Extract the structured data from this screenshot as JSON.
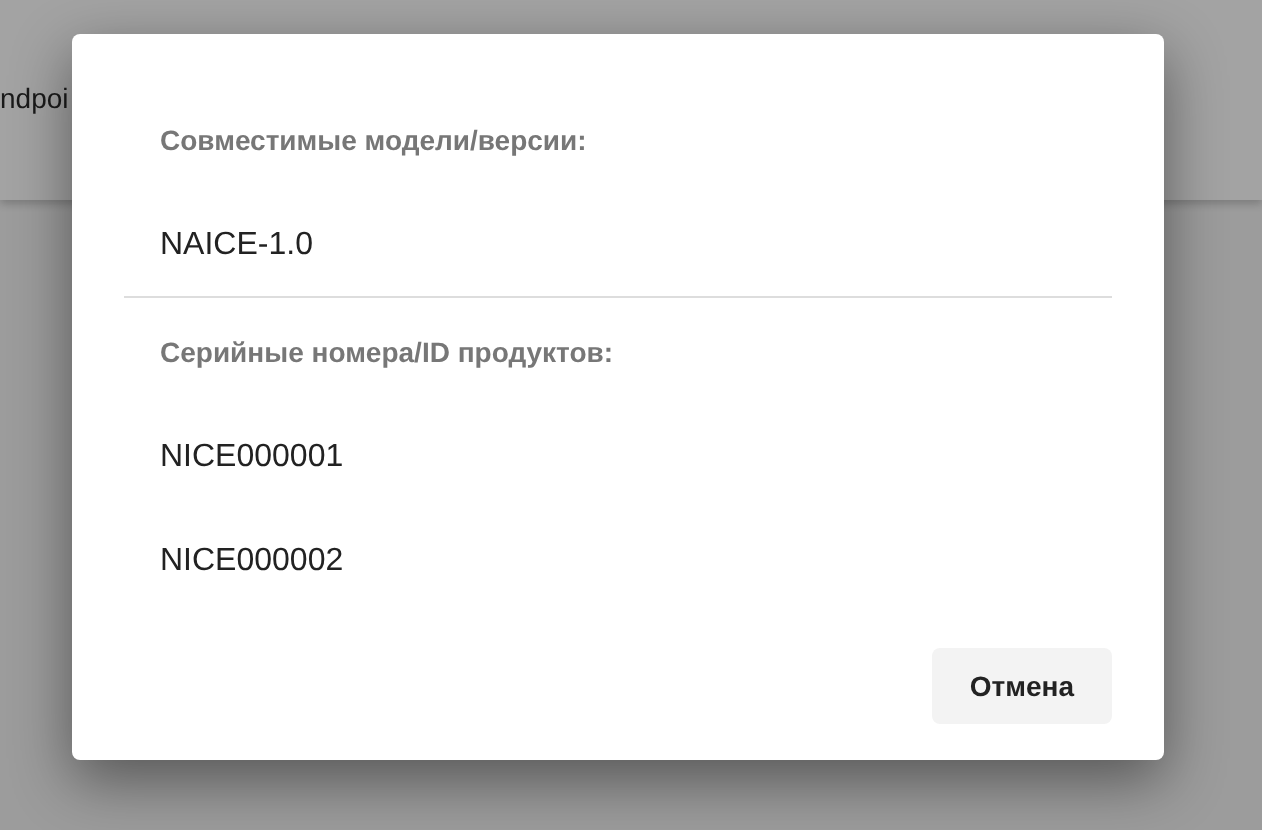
{
  "background": {
    "text": "ndpoi"
  },
  "dialog": {
    "sections": [
      {
        "label": "Совместимые модели/версии:",
        "items": [
          "NAICE-1.0"
        ]
      },
      {
        "label": "Серийные номера/ID продуктов:",
        "items": [
          "NICE000001",
          "NICE000002"
        ]
      }
    ],
    "buttons": [
      "Отмена"
    ]
  }
}
